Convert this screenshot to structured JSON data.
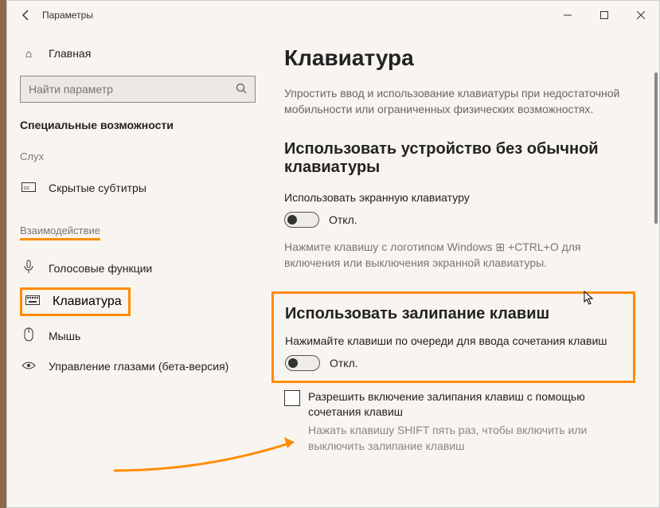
{
  "titlebar": {
    "title": "Параметры"
  },
  "sidebar": {
    "home": "Главная",
    "search_placeholder": "Найти параметр",
    "section": "Специальные возможности",
    "group_hearing": "Слух",
    "item_captions": "Скрытые субтитры",
    "group_interaction": "Взаимодействие",
    "item_speech": "Голосовые функции",
    "item_keyboard": "Клавиатура",
    "item_mouse": "Мышь",
    "item_eye": "Управление глазами (бета-версия)"
  },
  "content": {
    "title": "Клавиатура",
    "intro": "Упростить ввод и использование клавиатуры при недостаточной мобильности или ограниченных физических возможностях.",
    "osk_heading": "Использовать устройство без обычной клавиатуры",
    "osk_label": "Использовать экранную клавиатуру",
    "osk_state": "Откл.",
    "osk_hint": "Нажмите клавишу с логотипом Windows ⊞ +CTRL+O для включения или выключения экранной клавиатуры.",
    "sticky_heading": "Использовать залипание клавиш",
    "sticky_label": "Нажимайте клавиши по очереди для ввода сочетания клавиш",
    "sticky_state": "Откл.",
    "check_label": "Разрешить включение залипания клавиш с помощью сочетания клавиш",
    "check_hint": "Нажать клавишу SHIFT пять раз, чтобы включить или выключить залипание клавиш"
  }
}
